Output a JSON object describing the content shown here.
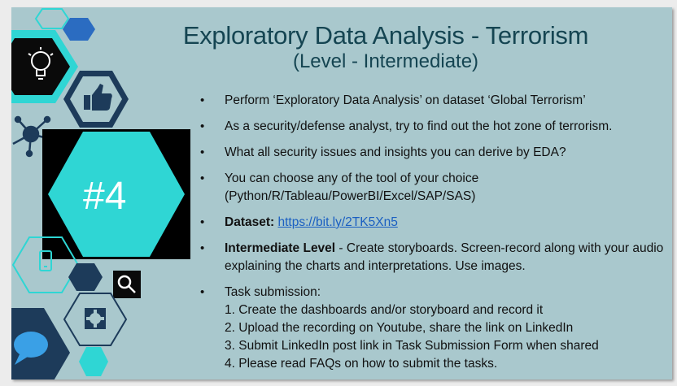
{
  "slide": {
    "title": "Exploratory Data Analysis - Terrorism",
    "subtitle": "(Level - Intermediate)",
    "badge": "#4"
  },
  "bullets": {
    "b1": "Perform ‘Exploratory Data Analysis’ on dataset ‘Global Terrorism’",
    "b2": "As a security/defense analyst, try to find out the hot zone of terrorism.",
    "b3": "What all security issues and insights you can derive by EDA?",
    "b4_line1": "You can choose any of the tool of your choice",
    "b4_line2": "(Python/R/Tableau/PowerBI/Excel/SAP/SAS)",
    "b5_label": "Dataset:",
    "b5_link": "https://bit.ly/2TK5Xn5",
    "b6_label": "Intermediate Level",
    "b6_text": " - Create storyboards. Screen-record along with your audio explaining the charts and interpretations. Use images.",
    "b7_heading": "Task submission:",
    "tasks": [
      "1. Create the dashboards and/or storyboard and record it",
      "2. Upload the recording on Youtube, share the link on LinkedIn",
      "3. Submit LinkedIn post link in Task Submission Form when shared",
      "4. Please read FAQs on how to submit the tasks."
    ]
  },
  "icons": [
    "lightbulb-icon",
    "thumbs-up-icon",
    "network-icon",
    "phone-icon",
    "search-icon",
    "gear-icon",
    "chat-icon"
  ],
  "colors": {
    "slide_bg": "#a9c8cd",
    "title": "#154552",
    "teal": "#2fd6d4",
    "dark_navy": "#1d3b5a",
    "blue": "#2b6cc1",
    "link": "#1a5fc2"
  }
}
